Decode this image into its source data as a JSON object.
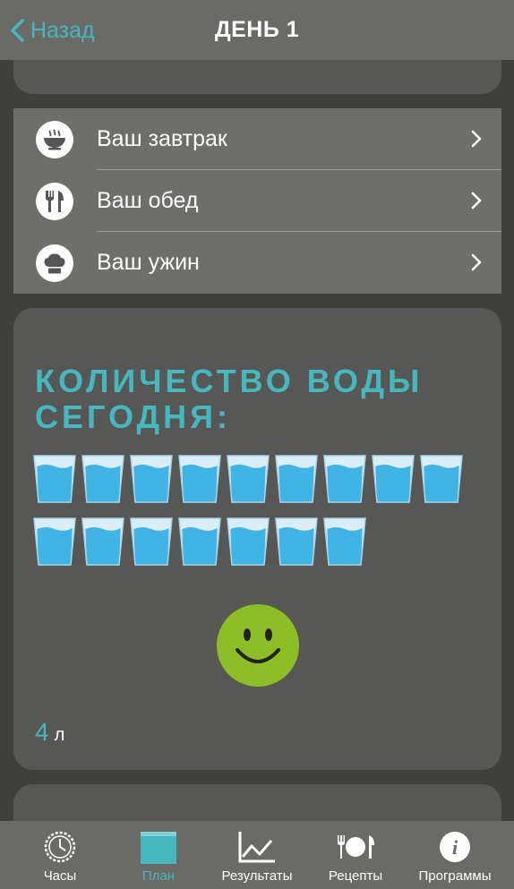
{
  "nav": {
    "back_label": "Назад",
    "title": "ДЕНЬ 1"
  },
  "meals": [
    {
      "label": "Ваш завтрак",
      "icon": "soup-bowl-icon"
    },
    {
      "label": "Ваш обед",
      "icon": "fork-knife-icon"
    },
    {
      "label": "Ваш ужин",
      "icon": "chef-hat-icon"
    }
  ],
  "water": {
    "title": "КОЛИЧЕСТВО ВОДЫ СЕГОДНЯ:",
    "glasses_filled": 16,
    "amount": "4",
    "unit": "л",
    "mood_icon": "smiley-icon"
  },
  "tabs": [
    {
      "label": "Часы",
      "icon": "clock-icon",
      "active": false
    },
    {
      "label": "План",
      "icon": "calendar-icon",
      "active": true
    },
    {
      "label": "Результаты",
      "icon": "chart-icon",
      "active": false
    },
    {
      "label": "Рецепты",
      "icon": "plate-cutlery-icon",
      "active": false
    },
    {
      "label": "Программы",
      "icon": "info-icon",
      "active": false
    }
  ],
  "colors": {
    "accent": "#44b8bd",
    "bar": "#6a6a66",
    "card": "#575755",
    "background": "#3f3f3c",
    "smiley": "#8cbf26",
    "water": "#3fb4e5"
  }
}
